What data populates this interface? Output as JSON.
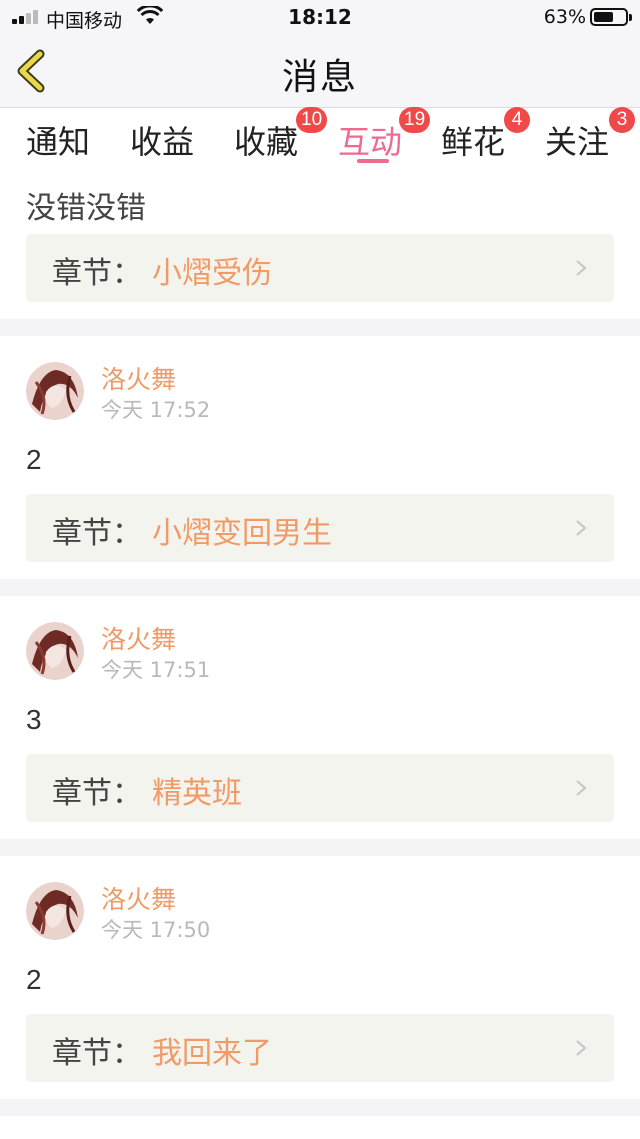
{
  "status_bar": {
    "carrier": "中国移动",
    "time": "18:12",
    "battery_percent": "63%",
    "battery_level": 0.63
  },
  "nav": {
    "title": "消息",
    "back_icon": "chevron-left-icon"
  },
  "tabs": [
    {
      "label": "通知",
      "badge": ""
    },
    {
      "label": "收益",
      "badge": ""
    },
    {
      "label": "收藏",
      "badge": "10"
    },
    {
      "label": "互动",
      "badge": "19",
      "active": true
    },
    {
      "label": "鲜花",
      "badge": "4"
    },
    {
      "label": "关注",
      "badge": "3"
    }
  ],
  "colors": {
    "accent_pink": "#ee6a8f",
    "name_orange": "#f29a67",
    "badge_red": "#f04949"
  },
  "feed": {
    "first": {
      "text": "没错没错",
      "chapter_label": "章节：",
      "chapter_title": "小熠受伤"
    },
    "cards": [
      {
        "user": "洛火舞",
        "time": "今天 17:52",
        "content": "2",
        "chapter_label": "章节：",
        "chapter_title": "小熠变回男生"
      },
      {
        "user": "洛火舞",
        "time": "今天 17:51",
        "content": "3",
        "chapter_label": "章节：",
        "chapter_title": "精英班"
      },
      {
        "user": "洛火舞",
        "time": "今天 17:50",
        "content": "2",
        "chapter_label": "章节：",
        "chapter_title": "我回来了"
      }
    ]
  }
}
